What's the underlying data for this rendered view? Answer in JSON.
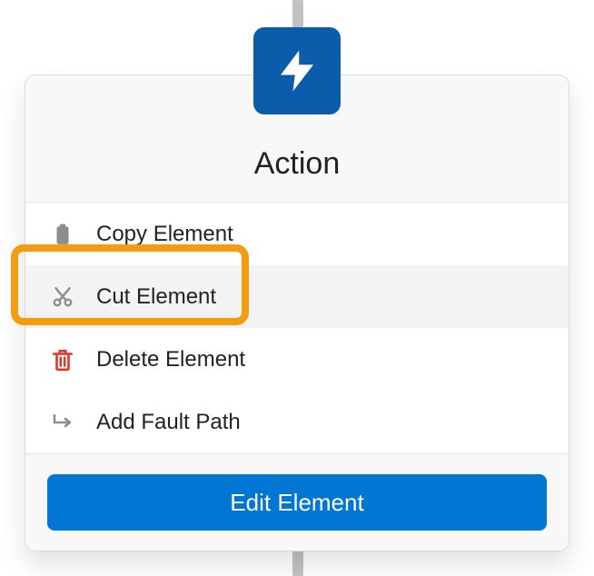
{
  "node": {
    "title": "Action",
    "icon_name": "lightning-icon"
  },
  "menu": {
    "items": [
      {
        "label": "Copy Element",
        "icon": "clipboard-icon",
        "interactable": true
      },
      {
        "label": "Cut Element",
        "icon": "scissors-icon",
        "interactable": true,
        "highlighted": true,
        "hovered": true
      },
      {
        "label": "Delete Element",
        "icon": "trash-icon",
        "interactable": true,
        "danger": true
      },
      {
        "label": "Add Fault Path",
        "icon": "fault-path-icon",
        "interactable": true
      }
    ]
  },
  "footer": {
    "edit_label": "Edit Element"
  },
  "colors": {
    "brand": "#0b5cab",
    "primary_button": "#0176d3",
    "danger": "#d83a2f",
    "highlight_border": "#f39c12",
    "neutral_icon": "#8d8d8d"
  }
}
